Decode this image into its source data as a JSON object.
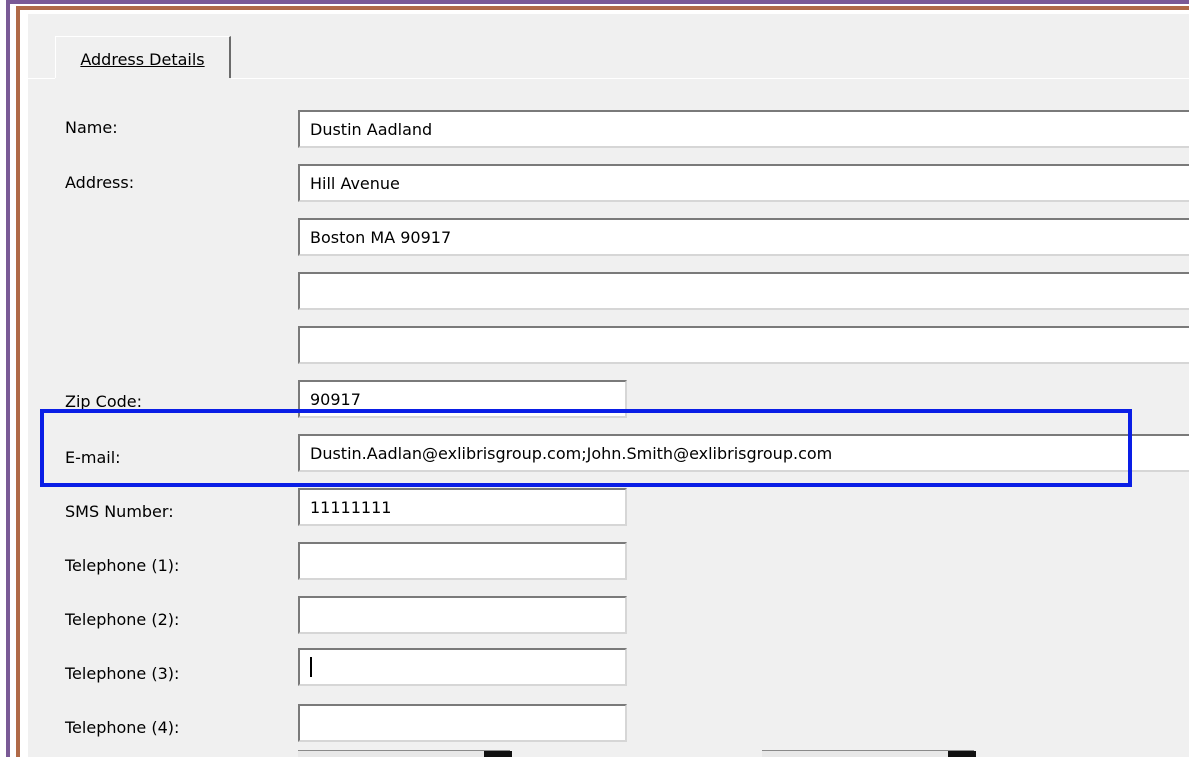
{
  "tab": {
    "label": "Address Details"
  },
  "form": {
    "name": {
      "label": "Name:",
      "value": "Dustin Aadland"
    },
    "address": {
      "label": "Address:",
      "lines": [
        "Hill Avenue",
        "Boston MA 90917",
        "",
        ""
      ]
    },
    "zip": {
      "label": "Zip Code:",
      "value": "90917"
    },
    "email": {
      "label": "E-mail:",
      "value": "Dustin.Aadlan@exlibrisgroup.com;John.Smith@exlibrisgroup.com"
    },
    "sms": {
      "label": "SMS Number:",
      "value": "11111111"
    },
    "telephone1": {
      "label": "Telephone (1):",
      "value": ""
    },
    "telephone2": {
      "label": "Telephone (2):",
      "value": ""
    },
    "telephone3": {
      "label": "Telephone (3):",
      "value": ""
    },
    "telephone4": {
      "label": "Telephone (4):",
      "value": ""
    }
  },
  "colors": {
    "highlight": "#0a1ee6",
    "outer_border": "#7a5a96",
    "inner_border": "#b06a48",
    "panel": "#f0f0f0"
  }
}
